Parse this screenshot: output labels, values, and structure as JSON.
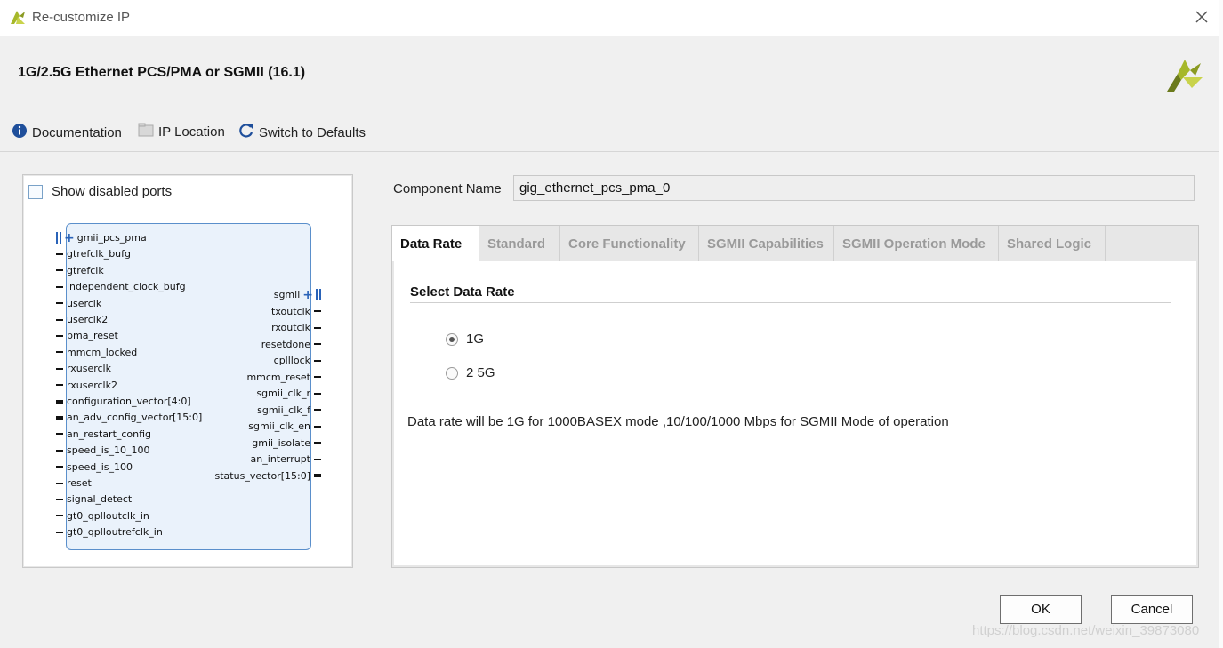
{
  "window": {
    "title": "Re-customize IP"
  },
  "header": {
    "heading": "1G/2.5G Ethernet PCS/PMA or SGMII (16.1)"
  },
  "toolbar": {
    "documentation": "Documentation",
    "ip_location": "IP Location",
    "switch_defaults": "Switch to Defaults"
  },
  "left_panel": {
    "show_disabled_ports": "Show disabled ports",
    "block": {
      "left_pins": [
        "gmii_pcs_pma",
        "gtrefclk_bufg",
        "gtrefclk",
        "independent_clock_bufg",
        "userclk",
        "userclk2",
        "pma_reset",
        "mmcm_locked",
        "rxuserclk",
        "rxuserclk2",
        "configuration_vector[4:0]",
        "an_adv_config_vector[15:0]",
        "an_restart_config",
        "speed_is_10_100",
        "speed_is_100",
        "reset",
        "signal_detect",
        "gt0_qplloutclk_in",
        "gt0_qplloutrefclk_in"
      ],
      "right_pins": [
        "sgmii",
        "txoutclk",
        "rxoutclk",
        "resetdone",
        "cplllock",
        "mmcm_reset",
        "sgmii_clk_r",
        "sgmii_clk_f",
        "sgmii_clk_en",
        "gmii_isolate",
        "an_interrupt",
        "status_vector[15:0]"
      ]
    }
  },
  "component": {
    "label": "Component Name",
    "value": "gig_ethernet_pcs_pma_0"
  },
  "tabs": [
    "Data Rate",
    "Standard",
    "Core Functionality",
    "SGMII Capabilities",
    "SGMII Operation Mode",
    "Shared Logic"
  ],
  "active_tab": "Data Rate",
  "data_rate": {
    "section_title": "Select Data Rate",
    "options": [
      "1G",
      "2 5G"
    ],
    "selected": "1G",
    "description": "Data rate will be 1G for 1000BASEX mode ,10/100/1000 Mbps for SGMII Mode of operation"
  },
  "buttons": {
    "ok": "OK",
    "cancel": "Cancel"
  },
  "watermark": "https://blog.csdn.net/weixin_39873080",
  "colors": {
    "accent": "#2a63b8",
    "logo_green": "#a6b82a",
    "logo_olive": "#6b7a1c",
    "block_border": "#5a8fcb",
    "block_fill": "#eaf2fb"
  }
}
